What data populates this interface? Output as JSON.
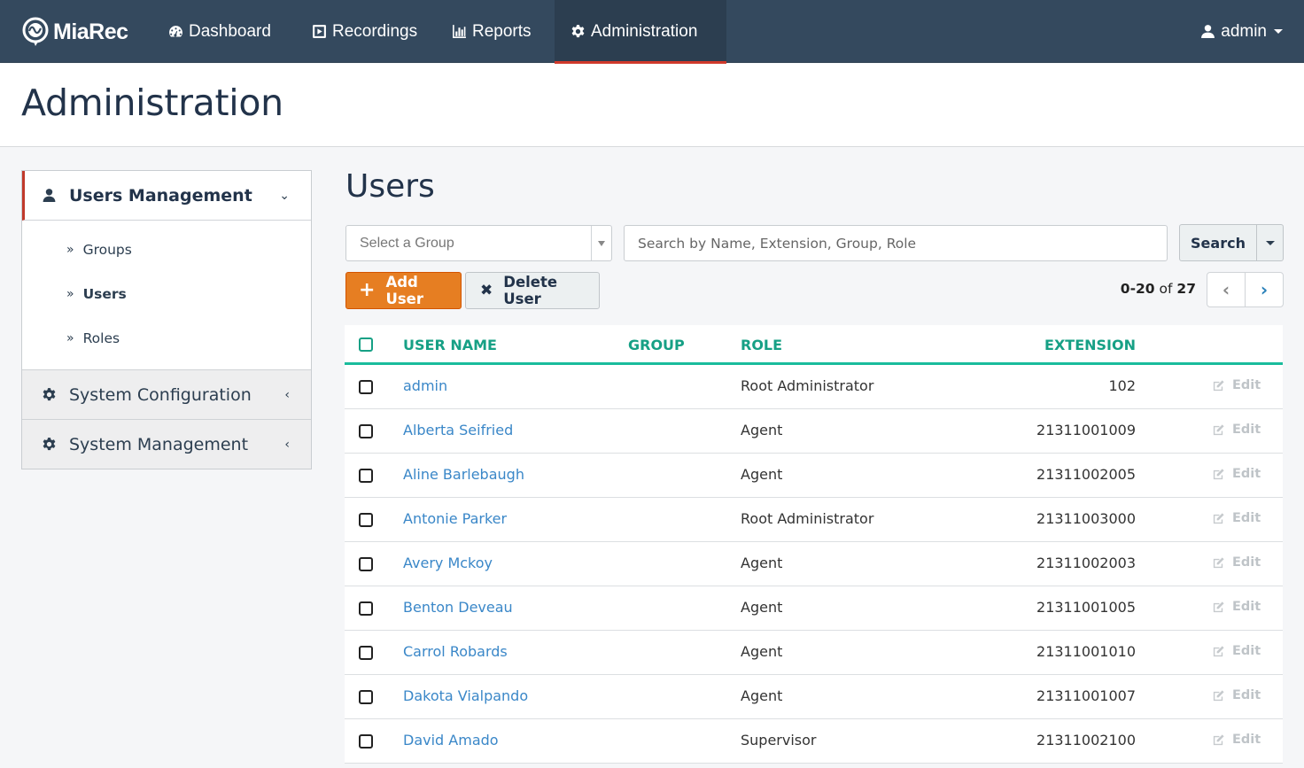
{
  "navbar": {
    "brand": "MiaRec",
    "items": [
      {
        "label": "Dashboard",
        "icon": "dashboard-icon"
      },
      {
        "label": "Recordings",
        "icon": "play-square-icon"
      },
      {
        "label": "Reports",
        "icon": "bar-chart-icon"
      },
      {
        "label": "Administration",
        "icon": "gear-icon",
        "active": true
      }
    ],
    "user": {
      "label": "admin",
      "icon": "user-icon"
    },
    "accent_color": "#d0392b"
  },
  "page": {
    "title": "Administration"
  },
  "sidebar": {
    "groups": [
      {
        "label": "Users Management",
        "icon": "user-icon",
        "expanded": true,
        "items": [
          {
            "label": "Groups",
            "active": false
          },
          {
            "label": "Users",
            "active": true
          },
          {
            "label": "Roles",
            "active": false
          }
        ]
      },
      {
        "label": "System Configuration",
        "icon": "gear-icon",
        "expanded": false
      },
      {
        "label": "System Management",
        "icon": "gear-icon",
        "expanded": false
      }
    ]
  },
  "main": {
    "title": "Users",
    "group_select": {
      "placeholder": "Select a Group"
    },
    "search": {
      "placeholder": "Search by Name, Extension, Group, Role",
      "value": "",
      "button_label": "Search"
    },
    "actions": {
      "add_label": "Add User",
      "delete_label": "Delete User"
    },
    "pagination": {
      "range": "0-20",
      "of_label": "of",
      "total": "27"
    },
    "table": {
      "columns": [
        "USER NAME",
        "GROUP",
        "ROLE",
        "EXTENSION"
      ],
      "edit_label": "Edit",
      "rows": [
        {
          "name": "admin",
          "group": "",
          "role": "Root Administrator",
          "extension": "102"
        },
        {
          "name": "Alberta Seifried",
          "group": "",
          "role": "Agent",
          "extension": "21311001009"
        },
        {
          "name": "Aline Barlebaugh",
          "group": "",
          "role": "Agent",
          "extension": "21311002005"
        },
        {
          "name": "Antonie Parker",
          "group": "",
          "role": "Root Administrator",
          "extension": "21311003000"
        },
        {
          "name": "Avery Mckoy",
          "group": "",
          "role": "Agent",
          "extension": "21311002003"
        },
        {
          "name": "Benton Deveau",
          "group": "",
          "role": "Agent",
          "extension": "21311001005"
        },
        {
          "name": "Carrol Robards",
          "group": "",
          "role": "Agent",
          "extension": "21311001010"
        },
        {
          "name": "Dakota Vialpando",
          "group": "",
          "role": "Agent",
          "extension": "21311001007"
        },
        {
          "name": "David Amado",
          "group": "",
          "role": "Supervisor",
          "extension": "21311002100"
        }
      ]
    }
  }
}
